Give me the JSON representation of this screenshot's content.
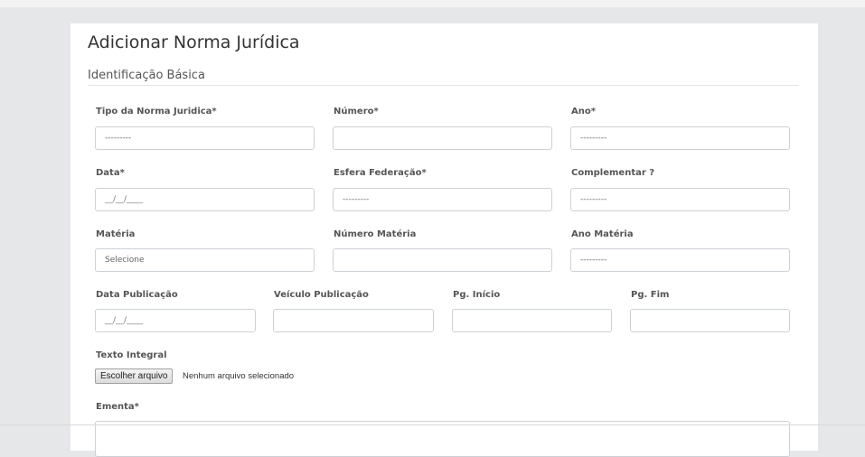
{
  "form": {
    "title": "Adicionar Norma Jurídica",
    "section": "Identificação Básica"
  },
  "fields": {
    "tipo": {
      "label": "Tipo da Norma Juridica*",
      "value": "---------"
    },
    "numero": {
      "label": "Número*",
      "value": ""
    },
    "ano": {
      "label": "Ano*",
      "value": "---------"
    },
    "data": {
      "label": "Data*",
      "value": "__/__/____"
    },
    "esfera": {
      "label": "Esfera Federação*",
      "value": "---------"
    },
    "complementar": {
      "label": "Complementar ?",
      "value": "---------"
    },
    "materia": {
      "label": "Matéria",
      "value": "Selecione"
    },
    "numero_materia": {
      "label": "Número Matéria",
      "value": ""
    },
    "ano_materia": {
      "label": "Ano Matéria",
      "value": "---------"
    },
    "data_publicacao": {
      "label": "Data Publicação",
      "value": "__/__/____"
    },
    "veiculo_publicacao": {
      "label": "Veículo Publicação",
      "value": ""
    },
    "pg_inicio": {
      "label": "Pg. Início",
      "value": ""
    },
    "pg_fim": {
      "label": "Pg. Fim",
      "value": ""
    },
    "texto_integral": {
      "label": "Texto Integral",
      "button": "Escolher arquivo",
      "status": "Nenhum arquivo selecionado"
    },
    "ementa": {
      "label": "Ementa*",
      "value": ""
    }
  }
}
